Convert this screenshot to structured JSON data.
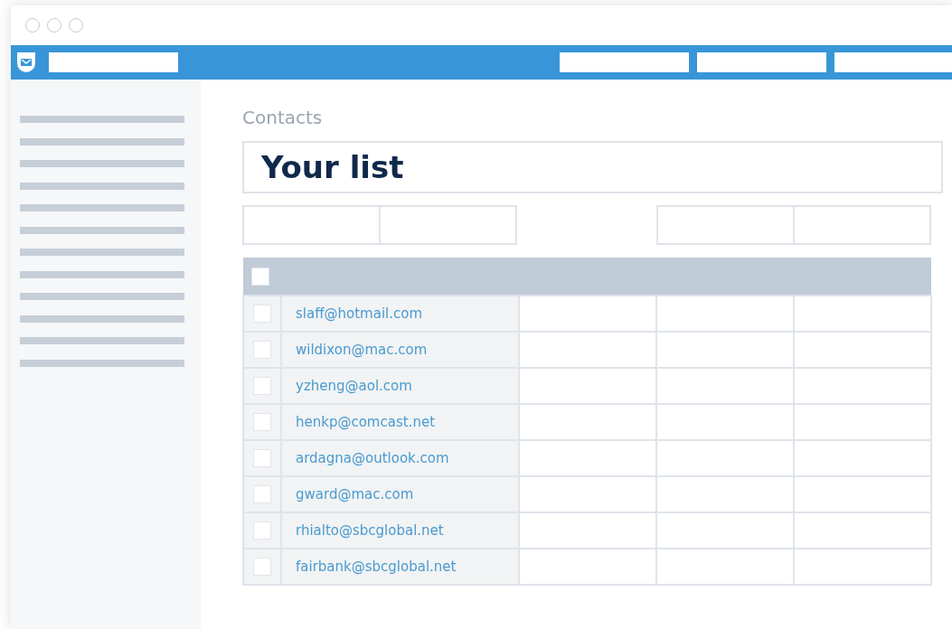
{
  "page": {
    "heading": "Contacts",
    "list_title": "Your list"
  },
  "table": {
    "header_checked": false,
    "rows": [
      {
        "email": "slaff@hotmail.com",
        "checked": false
      },
      {
        "email": "wildixon@mac.com",
        "checked": false
      },
      {
        "email": "yzheng@aol.com",
        "checked": false
      },
      {
        "email": "henkp@comcast.net",
        "checked": false
      },
      {
        "email": "ardagna@outlook.com",
        "checked": false
      },
      {
        "email": "gward@mac.com",
        "checked": false
      },
      {
        "email": "rhialto@sbcglobal.net",
        "checked": false
      },
      {
        "email": "fairbank@sbcglobal.net",
        "checked": false
      }
    ]
  }
}
